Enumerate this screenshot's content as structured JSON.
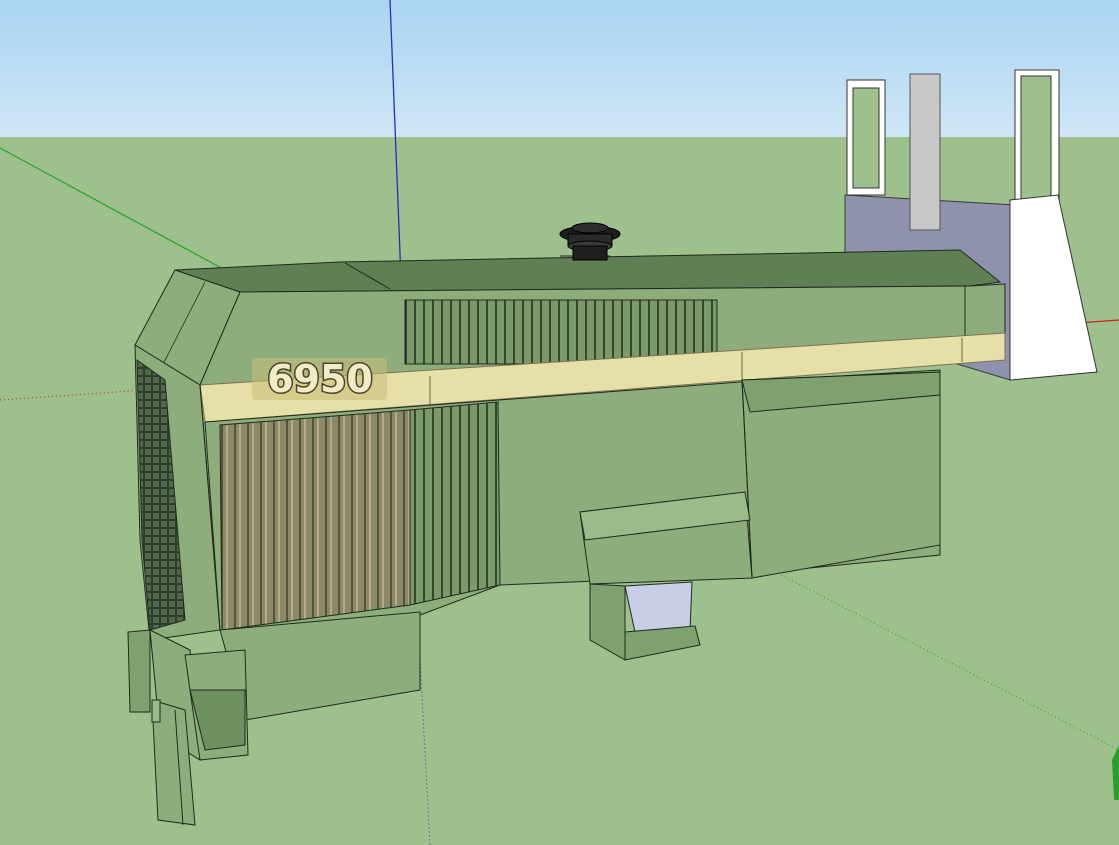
{
  "viewport": {
    "colors": {
      "sky": "#c3e1f5",
      "sky_top": "#a8d4f2",
      "ground": "#9dc08d",
      "hood_green": "#8ead7c",
      "hood_dark": "#5f7f55",
      "stripe": "#e6dfa7",
      "axis_red": "#d42020",
      "axis_green": "#2aa02a",
      "axis_blue": "#2020c8",
      "panel_gray": "#8e92ad",
      "white": "#ffffff"
    }
  },
  "model": {
    "name": "tractor-hood",
    "badge_text": "6950"
  }
}
